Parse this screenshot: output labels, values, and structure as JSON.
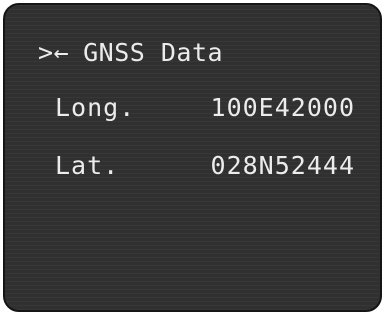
{
  "screen": {
    "title": "GNSS Data",
    "back_symbol": ">←",
    "rows": [
      {
        "label": "Long.",
        "value": "100E42000"
      },
      {
        "label": "Lat.",
        "value": "028N52444"
      }
    ]
  },
  "colors": {
    "screen_background": "#303030",
    "text": "#ececec",
    "bezel": "#151515"
  }
}
